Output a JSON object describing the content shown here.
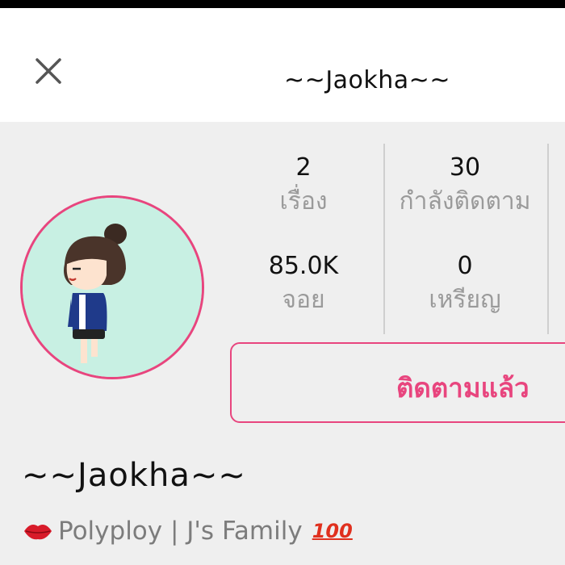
{
  "header": {
    "title": "~~Jaokha~~"
  },
  "stats": [
    {
      "value": "2",
      "label": "เรื่อง"
    },
    {
      "value": "30",
      "label": "กำลังติดตาม"
    },
    {
      "value": "85.0K",
      "label": "จอย"
    },
    {
      "value": "0",
      "label": "เหรียญ"
    }
  ],
  "follow_button": {
    "label": "ติดตามแล้ว"
  },
  "profile": {
    "name": "~~Jaokha~~",
    "bio_text": "Polyploy | J's Family",
    "bio_emoji": "100"
  },
  "colors": {
    "accent": "#e8457e",
    "background": "#efefef",
    "header": "#ffffff",
    "avatar_bg": "#c8f0e3"
  },
  "icons": [
    "close-icon",
    "lips-icon",
    "hundred-points-icon"
  ]
}
